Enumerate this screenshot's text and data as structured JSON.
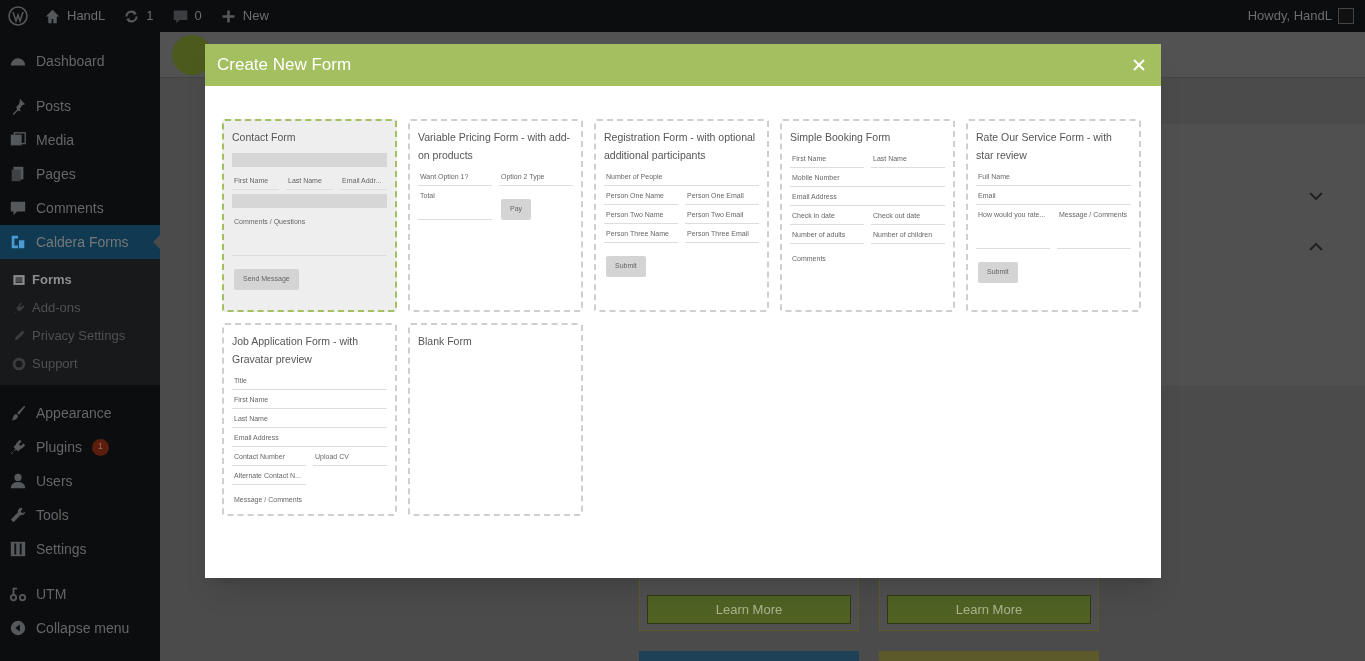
{
  "admin_bar": {
    "site": "HandL",
    "updates": "1",
    "comments": "0",
    "new": "New",
    "greeting": "Howdy, HandL"
  },
  "sidebar": {
    "groups": [
      [
        {
          "label": "Dashboard",
          "selected": false
        }
      ],
      [
        {
          "label": "Posts",
          "selected": false
        },
        {
          "label": "Media",
          "selected": false
        },
        {
          "label": "Pages",
          "selected": false
        },
        {
          "label": "Comments",
          "selected": false
        },
        {
          "label": "Caldera Forms",
          "selected": true,
          "children": [
            {
              "label": "Forms",
              "selected": true
            },
            {
              "label": "Add-ons",
              "selected": false
            },
            {
              "label": "Privacy Settings",
              "selected": false
            },
            {
              "label": "Support",
              "selected": false
            }
          ]
        }
      ],
      [
        {
          "label": "Appearance",
          "selected": false
        },
        {
          "label": "Plugins",
          "selected": false,
          "badge": "1"
        },
        {
          "label": "Users",
          "selected": false
        },
        {
          "label": "Tools",
          "selected": false
        },
        {
          "label": "Settings",
          "selected": false
        }
      ],
      [
        {
          "label": "UTM",
          "selected": false
        },
        {
          "label": "Collapse menu",
          "selected": false
        }
      ]
    ]
  },
  "background": {
    "buttons": [
      "Learn More",
      "Learn More"
    ]
  },
  "modal": {
    "title": "Create New Form",
    "templates": [
      {
        "title": "Contact Form",
        "selected": true,
        "rows": [
          [
            {
              "kind": "bar"
            }
          ],
          [
            {
              "kind": "input",
              "label": "First Name"
            },
            {
              "kind": "input",
              "label": "Last Name"
            },
            {
              "kind": "input",
              "label": "Email Addr..."
            }
          ],
          [
            {
              "kind": "bar"
            }
          ],
          [
            {
              "kind": "area",
              "label": "Comments / Questions"
            }
          ],
          [
            {
              "kind": "button",
              "label": "Send Message"
            }
          ]
        ]
      },
      {
        "title": "Variable Pricing Form - with add-on products",
        "selected": false,
        "rows": [
          [
            {
              "kind": "input",
              "label": "Want Option 1?"
            },
            {
              "kind": "input",
              "label": "Option 2 Type"
            }
          ],
          [
            {
              "kind": "input",
              "label": "Total"
            },
            {
              "kind": "button",
              "label": "Pay"
            }
          ]
        ]
      },
      {
        "title": "Registration Form - with optional additional participants",
        "selected": false,
        "rows": [
          [
            {
              "kind": "input",
              "label": "Number of People"
            }
          ],
          [
            {
              "kind": "input",
              "label": "Person One Name"
            },
            {
              "kind": "input",
              "label": "Person One Email"
            }
          ],
          [
            {
              "kind": "input",
              "label": "Person Two Name"
            },
            {
              "kind": "input",
              "label": "Person Two Email"
            }
          ],
          [
            {
              "kind": "input",
              "label": "Person Three Name"
            },
            {
              "kind": "input",
              "label": "Person Three Email"
            }
          ],
          [
            {
              "kind": "button",
              "label": "Submit"
            }
          ]
        ]
      },
      {
        "title": "Simple Booking Form",
        "selected": false,
        "rows": [
          [
            {
              "kind": "input",
              "label": "First Name"
            },
            {
              "kind": "input",
              "label": "Last Name"
            }
          ],
          [
            {
              "kind": "input",
              "label": "Mobile Number"
            }
          ],
          [
            {
              "kind": "input",
              "label": "Email Address"
            }
          ],
          [
            {
              "kind": "input",
              "label": "Check in date"
            },
            {
              "kind": "input",
              "label": "Check out date"
            }
          ],
          [
            {
              "kind": "input",
              "label": "Number of adults"
            },
            {
              "kind": "input",
              "label": "Number of children"
            }
          ],
          [
            {
              "kind": "label",
              "label": "Comments"
            }
          ]
        ]
      },
      {
        "title": "Rate Our Service Form - with star review",
        "selected": false,
        "rows": [
          [
            {
              "kind": "input",
              "label": "Full Name"
            }
          ],
          [
            {
              "kind": "input",
              "label": "Email"
            }
          ],
          [
            {
              "kind": "input",
              "label": "How would you rate..."
            },
            {
              "kind": "area",
              "label": "Message / Comments"
            }
          ],
          [
            {
              "kind": "button",
              "label": "Submit"
            }
          ]
        ]
      },
      {
        "title": "Job Application Form - with Gravatar preview",
        "selected": false,
        "rows": [
          [
            {
              "kind": "input",
              "label": "Title"
            }
          ],
          [
            {
              "kind": "input",
              "label": "First Name"
            }
          ],
          [
            {
              "kind": "input",
              "label": "Last Name"
            }
          ],
          [
            {
              "kind": "input",
              "label": "Email Address"
            }
          ],
          [
            {
              "kind": "input",
              "label": "Contact Number"
            },
            {
              "kind": "input",
              "label": "Upload CV"
            }
          ],
          [
            {
              "kind": "half",
              "label": "Alternate Contact N..."
            }
          ],
          [
            {
              "kind": "label",
              "label": "Message / Comments"
            }
          ]
        ]
      },
      {
        "title": "Blank Form",
        "selected": false
      }
    ]
  }
}
